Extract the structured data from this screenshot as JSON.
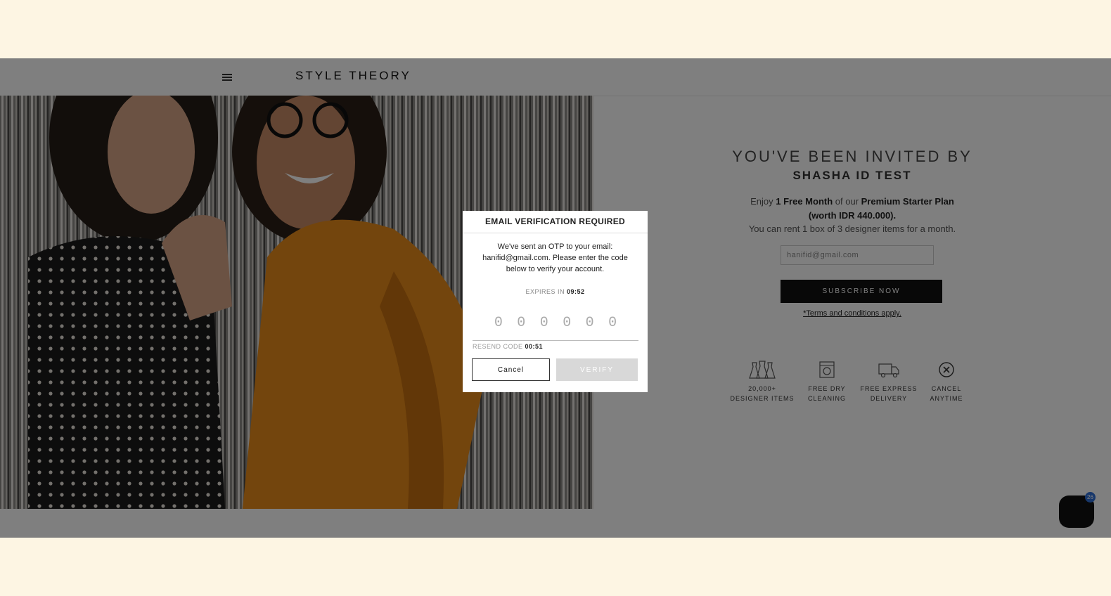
{
  "header": {
    "logo": "STYLE THEORY",
    "menu_icon": "hamburger-menu-icon"
  },
  "invite": {
    "title": "YOU'VE BEEN INVITED BY",
    "name": "SHASHA ID TEST",
    "offer_prefix": "Enjoy ",
    "offer_bold1": "1 Free Month",
    "offer_mid": " of our ",
    "offer_bold2": "Premium Starter Plan (worth IDR 440.000).",
    "offer_line2": "You can rent 1 box of 3 designer items for a month.",
    "email_value": "hanifid@gmail.com",
    "subscribe_label": "SUBSCRIBE NOW",
    "terms": "*Terms and conditions apply."
  },
  "features": [
    {
      "label1": "20,000+",
      "label2": "DESIGNER ITEMS",
      "icon": "dresses-icon"
    },
    {
      "label1": "FREE DRY",
      "label2": "CLEANING",
      "icon": "washing-machine-icon"
    },
    {
      "label1": "FREE EXPRESS",
      "label2": "DELIVERY",
      "icon": "delivery-truck-icon"
    },
    {
      "label1": "CANCEL",
      "label2": "ANYTIME",
      "icon": "cancel-circle-icon"
    }
  ],
  "chat": {
    "badge": "26",
    "icon": "chat-icon"
  },
  "modal": {
    "title": "EMAIL VERIFICATION REQUIRED",
    "message": "We've sent an OTP to your email: hanifid@gmail.com. Please enter the code below to verify your account.",
    "expires_label": "EXPIRES IN",
    "expires_time": "09:52",
    "otp_digits": [
      "0",
      "0",
      "0",
      "0",
      "0",
      "0"
    ],
    "resend_label": "RESEND CODE",
    "resend_time": "00:51",
    "cancel_label": "Cancel",
    "verify_label": "VERIFY"
  }
}
